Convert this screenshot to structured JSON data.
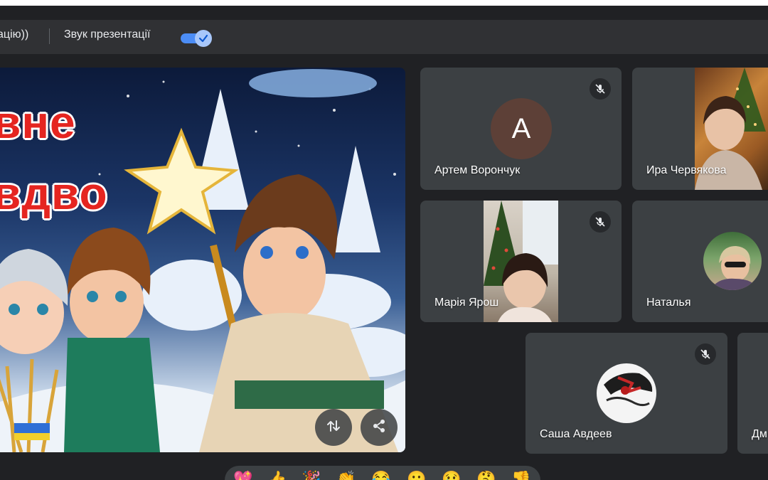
{
  "toolbar": {
    "stop_presenting_fragment": "ацію))",
    "presentation_sound_label": "Звук презентації",
    "presentation_sound_on": true
  },
  "presentation": {
    "title_line1": "вне",
    "title_line2": "вдво"
  },
  "participants": [
    {
      "name": "Артем Ворончук",
      "initial": "А",
      "muted": true,
      "avatar_color": "#5d4037"
    },
    {
      "name": "Ира Червякова",
      "muted": false
    },
    {
      "name": "Марія Ярош",
      "muted": true
    },
    {
      "name": "Наталья",
      "muted": false
    },
    {
      "name": "Саша Авдеев",
      "muted": true
    },
    {
      "name": "Дм",
      "muted": false
    }
  ],
  "reactions": [
    "💖",
    "👍",
    "🎉",
    "👏",
    "😂",
    "😮",
    "😢",
    "🤔",
    "👎"
  ],
  "icons": {
    "mic_off": "mic-off-icon",
    "swap": "swap-icon",
    "share": "share-icon",
    "check": "check-icon"
  }
}
